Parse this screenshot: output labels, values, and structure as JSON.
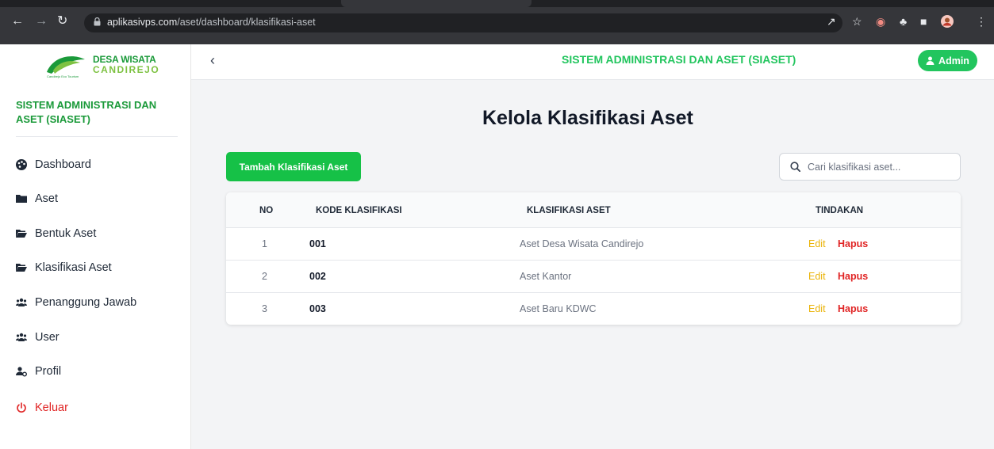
{
  "browser": {
    "url_domain": "aplikasivps.com",
    "url_path": "/aset/dashboard/klasifikasi-aset"
  },
  "sidebar": {
    "logo_line1": "DESA WISATA",
    "logo_line2": "CANDIREJO",
    "logo_tagline": "Candirejo Eco Tourism",
    "app_title": "SISTEM ADMINISTRASI DAN ASET (SIASET)",
    "menu": [
      {
        "label": "Dashboard",
        "icon": "palette-icon"
      },
      {
        "label": "Aset",
        "icon": "folder-icon"
      },
      {
        "label": "Bentuk Aset",
        "icon": "folder-open-icon"
      },
      {
        "label": "Klasifikasi Aset",
        "icon": "folder-open-icon"
      },
      {
        "label": "Penanggung Jawab",
        "icon": "users-icon"
      },
      {
        "label": "User",
        "icon": "users-icon"
      },
      {
        "label": "Profil",
        "icon": "user-cog-icon"
      },
      {
        "label": "Keluar",
        "icon": "power-icon"
      }
    ]
  },
  "header": {
    "title": "SISTEM ADMINISTRASI DAN ASET (SIASET)",
    "user_label": "Admin"
  },
  "main": {
    "page_title": "Kelola Klasifikasi Aset",
    "add_button": "Tambah Klasifikasi Aset",
    "search_placeholder": "Cari klasifikasi aset...",
    "table": {
      "headers": [
        "NO",
        "KODE KLASIFIKASI",
        "KLASIFIKASI ASET",
        "TINDAKAN"
      ],
      "rows": [
        {
          "no": "1",
          "kode": "001",
          "klasifikasi": "Aset Desa Wisata Candirejo",
          "edit": "Edit",
          "hapus": "Hapus"
        },
        {
          "no": "2",
          "kode": "002",
          "klasifikasi": "Aset Kantor",
          "edit": "Edit",
          "hapus": "Hapus"
        },
        {
          "no": "3",
          "kode": "003",
          "klasifikasi": "Aset Baru KDWC",
          "edit": "Edit",
          "hapus": "Hapus"
        }
      ]
    }
  },
  "colors": {
    "brand_green": "#22c55e",
    "button_green": "#16c147",
    "logout_red": "#e02424",
    "edit_yellow": "#eab308"
  }
}
